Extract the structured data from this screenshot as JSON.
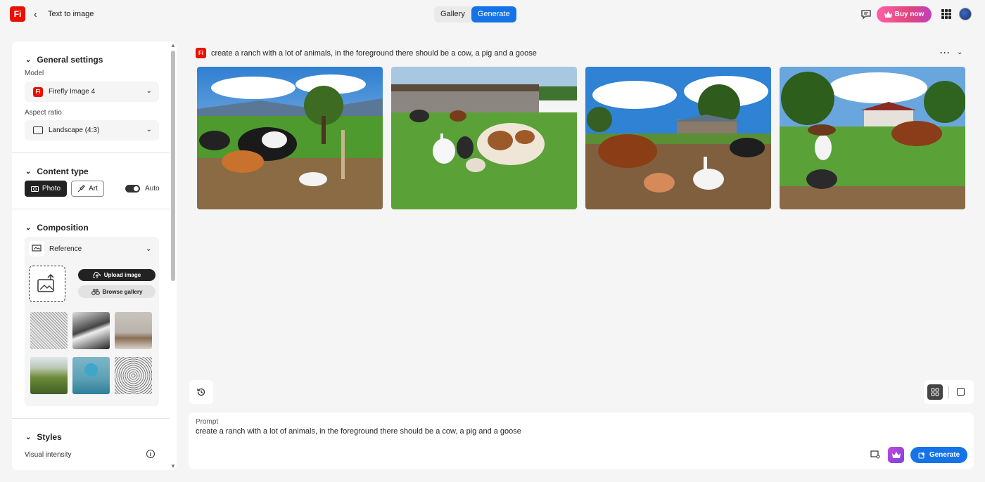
{
  "app": {
    "logo_text": "Fi",
    "page_title": "Text to image"
  },
  "nav": {
    "tabs": [
      {
        "label": "Gallery",
        "active": false
      },
      {
        "label": "Generate",
        "active": true
      }
    ]
  },
  "header": {
    "buy_label": "Buy now"
  },
  "panel": {
    "general": {
      "title": "General settings",
      "model_label": "Model",
      "model_value": "Firefly Image 4",
      "aspect_label": "Aspect ratio",
      "aspect_value": "Landscape (4:3)"
    },
    "content_type": {
      "title": "Content type",
      "photo_label": "Photo",
      "art_label": "Art",
      "auto_label": "Auto",
      "auto_on": true
    },
    "composition": {
      "title": "Composition",
      "reference_label": "Reference",
      "upload_label": "Upload image",
      "browse_label": "Browse gallery"
    },
    "styles": {
      "title": "Styles",
      "visual_intensity_label": "Visual intensity"
    }
  },
  "main": {
    "prompt_heading": "create a ranch with a lot of animals, in the foreground there should be a cow, a pig and a goose",
    "prompt_label": "Prompt",
    "prompt_value": "create a ranch with a lot of animals, in the foreground there should be a cow, a pig and a goose",
    "generate_label": "Generate"
  },
  "colors": {
    "accent": "#1473e6",
    "brand": "#eb1000",
    "buy_pink": "#e0457b"
  }
}
